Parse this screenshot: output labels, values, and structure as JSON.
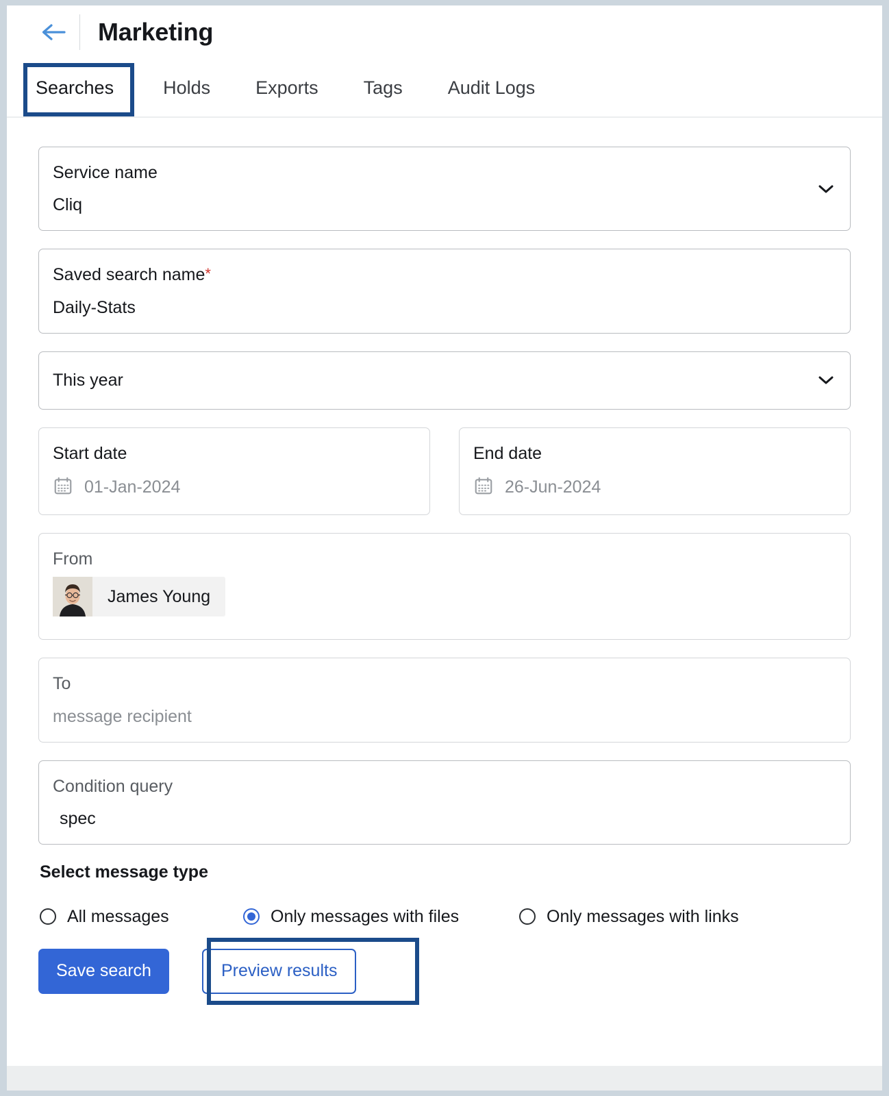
{
  "header": {
    "back_icon": "arrow-left-icon",
    "title": "Marketing"
  },
  "tabs": [
    {
      "label": "Searches",
      "active": true
    },
    {
      "label": "Holds",
      "active": false
    },
    {
      "label": "Exports",
      "active": false
    },
    {
      "label": "Tags",
      "active": false
    },
    {
      "label": "Audit Logs",
      "active": false
    }
  ],
  "form": {
    "service_name": {
      "label": "Service name",
      "value": "Cliq",
      "icon": "chevron-down-icon"
    },
    "saved_search_name": {
      "label": "Saved search name",
      "required_marker": "*",
      "value": "Daily-Stats"
    },
    "date_range": {
      "value": "This year",
      "icon": "chevron-down-icon"
    },
    "start_date": {
      "label": "Start date",
      "value": "01-Jan-2024",
      "icon": "calendar-icon"
    },
    "end_date": {
      "label": "End date",
      "value": "26-Jun-2024",
      "icon": "calendar-icon"
    },
    "from": {
      "label": "From",
      "chip_name": "James Young"
    },
    "to": {
      "label": "To",
      "placeholder": "message recipient"
    },
    "condition_query": {
      "label": "Condition query",
      "value": "spec"
    }
  },
  "message_type": {
    "title": "Select message type",
    "options": [
      {
        "label": "All messages",
        "selected": false
      },
      {
        "label": "Only messages with files",
        "selected": true
      },
      {
        "label": "Only messages with links",
        "selected": false
      }
    ]
  },
  "actions": {
    "save_label": "Save search",
    "preview_label": "Preview results"
  },
  "colors": {
    "highlight_box": "#1b4b8a",
    "primary_button": "#3366d6",
    "secondary_text": "#2b5fc4",
    "back_arrow": "#4a90d9",
    "required_asterisk": "#d0342c",
    "page_background": "#ccd6de"
  }
}
